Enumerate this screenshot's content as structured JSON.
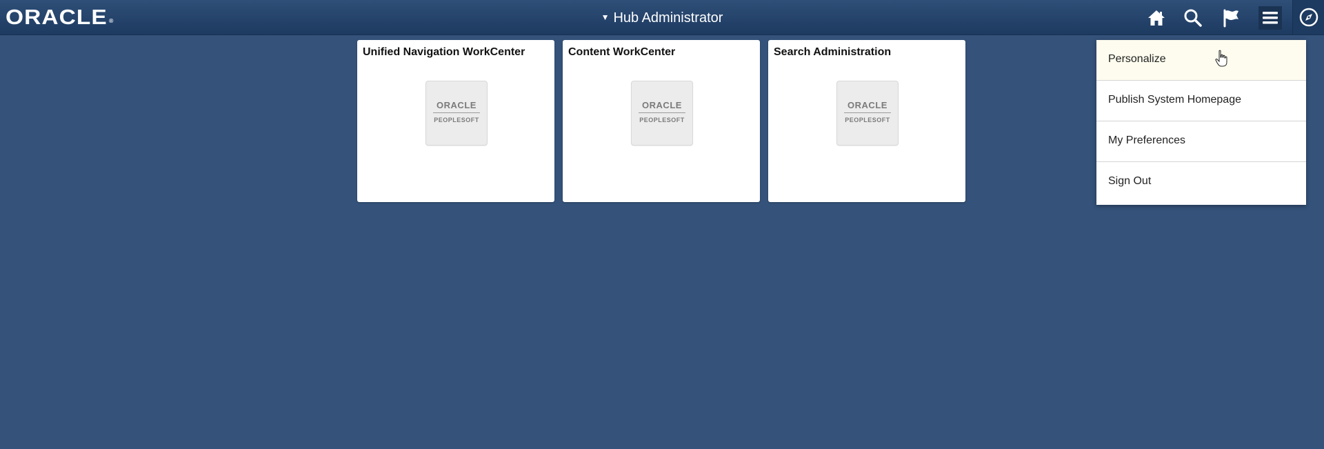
{
  "header": {
    "logo_text": "ORACLE",
    "logo_mark": "®",
    "title": "Hub Administrator",
    "title_caret": "▼",
    "icons": [
      "home-icon",
      "search-icon",
      "flag-icon",
      "menu-icon",
      "compass-icon"
    ]
  },
  "tiles": [
    {
      "title": "Unified Navigation WorkCenter",
      "logo_brand": "ORACLE",
      "logo_product": "PEOPLESOFT"
    },
    {
      "title": "Content WorkCenter",
      "logo_brand": "ORACLE",
      "logo_product": "PEOPLESOFT"
    },
    {
      "title": "Search Administration",
      "logo_brand": "ORACLE",
      "logo_product": "PEOPLESOFT"
    }
  ],
  "menu": {
    "items": [
      {
        "label": "Personalize"
      },
      {
        "label": "Publish System Homepage"
      },
      {
        "label": "My Preferences"
      },
      {
        "label": "Sign Out"
      }
    ]
  },
  "colors": {
    "background": "#34527a",
    "header": "#1d3a60",
    "menu_hover": "#fdfcee"
  }
}
